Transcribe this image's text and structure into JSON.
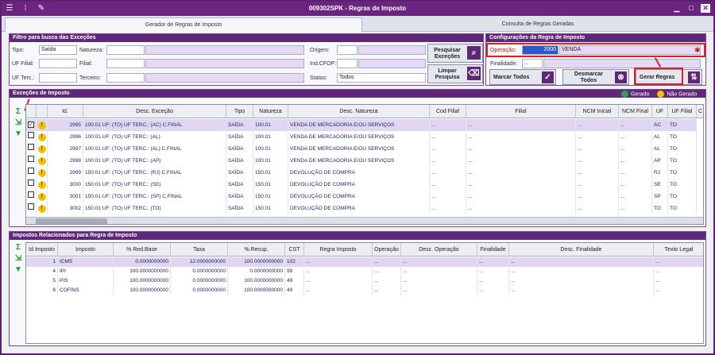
{
  "window": {
    "title": "009302SPK - Regras de Imposto"
  },
  "tabs": [
    {
      "label": "Gerador de Regras de Imposto"
    },
    {
      "label": "Consulta de Regras Geradas"
    }
  ],
  "filtro": {
    "title": "Filtro para busca das Exceções",
    "tipo_label": "Tipo:",
    "tipo_value": "Saída",
    "natureza_label": "Natureza:",
    "origem_label": "Origem:",
    "uf_filial_label": "UF Filial:",
    "filial_label": "Filial:",
    "indcfop_label": "Ind.CFOP:",
    "uf_terc_label": "UF Terc.:",
    "terceiro_label": "Terceiro:",
    "status_label": "Status:",
    "status_value": "Todos",
    "pesquisar_label": "Pesquisar Exceções",
    "limpar_label": "Limpar Pesquisa"
  },
  "config": {
    "title": "Configurações da Regra de Imposto",
    "operacao_label": "Operação:",
    "operacao_code": "2000",
    "operacao_desc": "VENDA",
    "finalidade_label": "Finalidade:",
    "finalidade_value": "...",
    "marcar_label": "Marcar Todos",
    "desmarcar_label": "Desmarcar Todos",
    "gerar_label": "Gerar Regras"
  },
  "excecoes": {
    "title": "Exceções de Imposto",
    "legend_gerado": "Gerado",
    "legend_nao_gerado": "Não Gerado",
    "columns": [
      "Id.",
      "Desc. Exceção",
      "Tipo",
      "Natureza",
      "Desc. Natureza",
      "Cod Filial",
      "Filial",
      "NCM Inicial",
      "NCM Final",
      "UF",
      "UF Filial",
      "C"
    ],
    "rows": [
      {
        "id": "2995",
        "desc": "100.01 UF: (TO) UF TERC.: (AC) C.FINAL",
        "tipo": "SAÍDA",
        "nat": "100.01",
        "descnat": "VENDA DE MERCADORIA E/OU SERVIÇOS",
        "codfilial": "...",
        "filial": "...",
        "ncmi": "...",
        "ncmf": "...",
        "uf": "AC",
        "uffilial": "TO",
        "checked": "✓"
      },
      {
        "id": "2996",
        "desc": "100.01 UF: (TO) UF TERC.: (AL)",
        "tipo": "SAÍDA",
        "nat": "100.01",
        "descnat": "VENDA DE MERCADORIA E/OU SERVIÇOS",
        "codfilial": "...",
        "filial": "...",
        "ncmi": "...",
        "ncmf": "...",
        "uf": "AL",
        "uffilial": "TO",
        "checked": ""
      },
      {
        "id": "2997",
        "desc": "100.01 UF: (TO) UF TERC.: (AL) C.FINAL",
        "tipo": "SAÍDA",
        "nat": "100.01",
        "descnat": "VENDA DE MERCADORIA E/OU SERVIÇOS",
        "codfilial": "...",
        "filial": "...",
        "ncmi": "...",
        "ncmf": "...",
        "uf": "AL",
        "uffilial": "TO",
        "checked": ""
      },
      {
        "id": "2998",
        "desc": "100.01 UF: (TO) UF TERC.: (AP)",
        "tipo": "SAÍDA",
        "nat": "100.01",
        "descnat": "VENDA DE MERCADORIA E/OU SERVIÇOS",
        "codfilial": "...",
        "filial": "...",
        "ncmi": "...",
        "ncmf": "...",
        "uf": "AP",
        "uffilial": "TO",
        "checked": ""
      },
      {
        "id": "2999",
        "desc": "150.01 UF: (TO) UF TERC.: (RJ) C.FINAL",
        "tipo": "SAÍDA",
        "nat": "150.01",
        "descnat": "DEVOLUÇÃO DE COMPRA",
        "codfilial": "...",
        "filial": "...",
        "ncmi": "...",
        "ncmf": "...",
        "uf": "RJ",
        "uffilial": "TO",
        "checked": ""
      },
      {
        "id": "3000",
        "desc": "150.01 UF: (TO) UF TERC.: (SE)",
        "tipo": "SAÍDA",
        "nat": "150.01",
        "descnat": "DEVOLUÇÃO DE COMPRA",
        "codfilial": "...",
        "filial": "...",
        "ncmi": "...",
        "ncmf": "...",
        "uf": "SE",
        "uffilial": "TO",
        "checked": ""
      },
      {
        "id": "3001",
        "desc": "150.01 UF: (TO) UF TERC.: (SP) C.FINAL",
        "tipo": "SAÍDA",
        "nat": "150.01",
        "descnat": "DEVOLUÇÃO DE COMPRA",
        "codfilial": "...",
        "filial": "...",
        "ncmi": "...",
        "ncmf": "...",
        "uf": "SP",
        "uffilial": "TO",
        "checked": ""
      },
      {
        "id": "3002",
        "desc": "150.01 UF: (TO) UF TERC.: (TO)",
        "tipo": "SAÍDA",
        "nat": "150.01",
        "descnat": "DEVOLUÇÃO DE COMPRA",
        "codfilial": "...",
        "filial": "...",
        "ncmi": "...",
        "ncmf": "...",
        "uf": "TO",
        "uffilial": "TO",
        "checked": ""
      }
    ]
  },
  "impostos": {
    "title": "Impostos Relacionados para Regra de Imposto",
    "columns": [
      "Id Imposto",
      "Imposto",
      "% Red.Base",
      "Taxa",
      "%.Recup.",
      "CST",
      "Regra Imposto",
      "Operação",
      "Desc. Operação",
      "Finalidade",
      "Desc. Finalidade",
      "Texto Legal"
    ],
    "rows": [
      {
        "id": "1",
        "imposto": "ICMS",
        "redbase": "0.0000000000",
        "taxa": "12.0000000000",
        "recup": "100.0000000000",
        "cst": "102",
        "regra": "...",
        "op": "...",
        "descop": "...",
        "fin": "...",
        "descfin": "...",
        "texto": "..."
      },
      {
        "id": "4",
        "imposto": "IPI",
        "redbase": "100.0000000000",
        "taxa": "0.0000000000",
        "recup": "0.0000000000",
        "cst": "99",
        "regra": "...",
        "op": "...",
        "descop": "...",
        "fin": "...",
        "descfin": "...",
        "texto": "..."
      },
      {
        "id": "5",
        "imposto": "PIS",
        "redbase": "100.0000000000",
        "taxa": "0.0000000000",
        "recup": "100.0000000000",
        "cst": "49",
        "regra": "...",
        "op": "...",
        "descop": "...",
        "fin": "...",
        "descfin": "...",
        "texto": "..."
      },
      {
        "id": "6",
        "imposto": "COFINS",
        "redbase": "100.0000000000",
        "taxa": "0.0000000000",
        "recup": "100.0000000000",
        "cst": "49",
        "regra": "...",
        "op": "...",
        "descop": "...",
        "fin": "...",
        "descfin": "...",
        "texto": "..."
      }
    ]
  },
  "colors": {
    "brand": "#6b2581",
    "selection": "#e0d6f2",
    "highlight": "#e02020"
  }
}
